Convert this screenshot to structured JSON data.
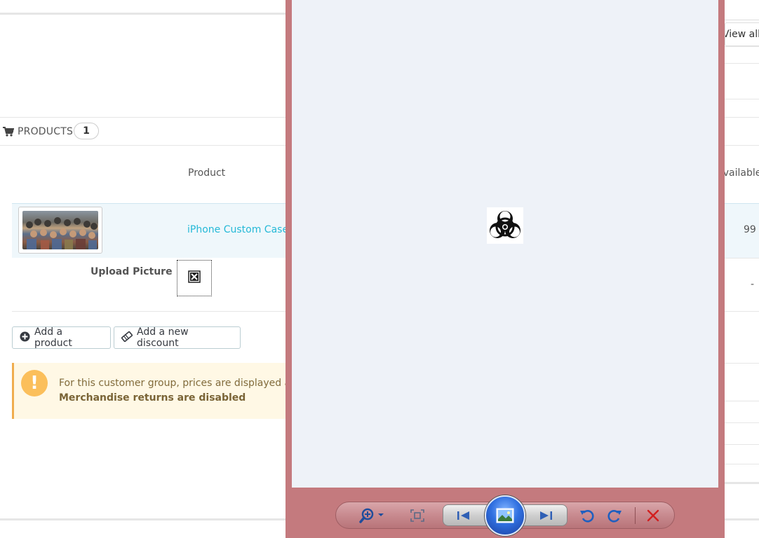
{
  "products_panel": {
    "title": "PRODUCTS",
    "count": "1",
    "column_product": "Product",
    "product_name": "iPhone Custom Case",
    "upload_label": "Upload Picture",
    "add_product_label": "Add a product",
    "add_discount_label": "Add a new discount"
  },
  "alert": {
    "line1": "For this customer group, prices are displayed as",
    "line2": "Merchandise returns are disabled"
  },
  "right_panel": {
    "view_all": "View all messages",
    "column_available": "Available",
    "quantity": "99",
    "dash": "-"
  },
  "viewer": {
    "image_icon": "biohazard-icon",
    "toolbar": [
      "zoom-icon",
      "actual-size-icon",
      "previous-icon",
      "slideshow-icon",
      "next-icon",
      "rotate-counterclockwise-icon",
      "rotate-clockwise-icon",
      "delete-icon"
    ]
  },
  "colors": {
    "link": "#25b9d7",
    "viewer_frame": "#c47a7e",
    "viewer_canvas": "#eef2f8",
    "alert_bg": "#fff8e5"
  }
}
